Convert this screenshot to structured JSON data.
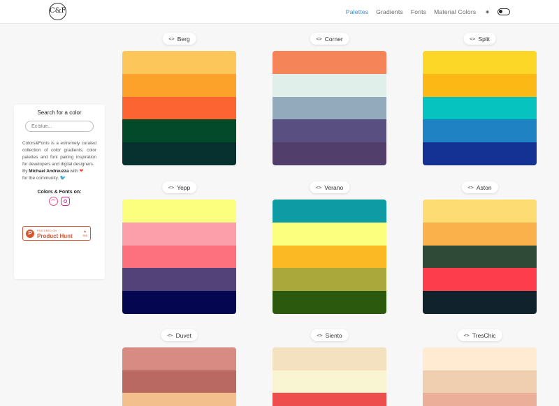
{
  "header": {
    "logo": "C&F",
    "nav": [
      {
        "label": "Palettes",
        "active": true
      },
      {
        "label": "Gradients",
        "active": false
      },
      {
        "label": "Fonts",
        "active": false
      },
      {
        "label": "Material Colors",
        "active": false
      }
    ],
    "theme_icon": "sun-icon"
  },
  "sidebar": {
    "title": "Search for a color",
    "search_placeholder": "Ex:blue...",
    "description": "Colors&Fonts is a extremely curated collection of color gradients, color palettes and font pairing inspiration for developers and digital designers.",
    "by_prefix": "By",
    "author": "Michael Andreuzza",
    "with": "with",
    "community": "for the community.",
    "on_label": "Colors & Fonts on:",
    "product_hunt": {
      "small": "FEATURED ON",
      "big": "Product Hunt",
      "count": "555"
    }
  },
  "palettes": [
    {
      "name": "Berg",
      "colors": [
        "#fdc65a",
        "#fca12a",
        "#fc6432",
        "#034a2b",
        "#07312f"
      ]
    },
    {
      "name": "Corner",
      "colors": [
        "#f58458",
        "#e0efe9",
        "#93a9bc",
        "#594f80",
        "#513e6b"
      ]
    },
    {
      "name": "Split",
      "colors": [
        "#fdd727",
        "#fcb916",
        "#06c3bf",
        "#1e82c3",
        "#143294"
      ]
    },
    {
      "name": "Yepp",
      "colors": [
        "#fcff7d",
        "#fd9eab",
        "#fc717d",
        "#534279",
        "#050650"
      ]
    },
    {
      "name": "Verano",
      "colors": [
        "#0f9ba4",
        "#fcff7d",
        "#fbb924",
        "#aba83b",
        "#2b5a0f"
      ]
    },
    {
      "name": "Aston",
      "colors": [
        "#fcdc73",
        "#fab04b",
        "#2f4b37",
        "#fd3d4c",
        "#10222b"
      ]
    },
    {
      "name": "Duvet",
      "colors": [
        "#d78b82",
        "#b96862",
        "#f3c08d"
      ]
    },
    {
      "name": "Siento",
      "colors": [
        "#f4e1c0",
        "#f9f4d2",
        "#ed4d4c"
      ]
    },
    {
      "name": "TresChic",
      "colors": [
        "#feebd1",
        "#f0cfb0",
        "#ebae98"
      ]
    }
  ],
  "tag_code": "<>"
}
